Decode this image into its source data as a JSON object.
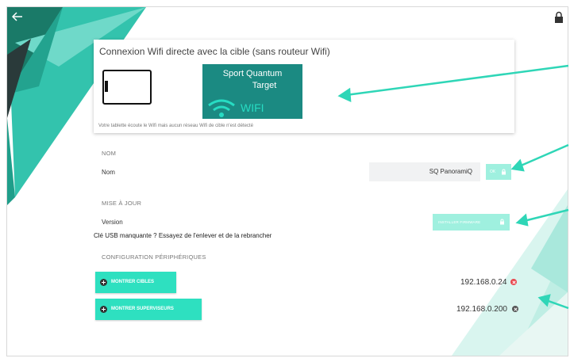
{
  "card": {
    "title": "Connexion Wifi directe avec la cible (sans routeur Wifi)",
    "target_line1": "Sport Quantum",
    "target_line2": "Target",
    "target_wifi": "WIFI",
    "note": "Votre tablette écoute le Wifi mais aucun réseau Wifi de cible n'est détecté"
  },
  "name_section": {
    "header": "NOM",
    "label": "Nom",
    "value": "SQ PanoramiQ",
    "ok_label": "OK"
  },
  "update_section": {
    "header": "MISE À JOUR",
    "label": "Version",
    "install_label": "INSTALLER FIRMWARE",
    "usb_note": "Clé USB manquante ? Essayez de l'enlever et de la rebrancher"
  },
  "peripherals": {
    "header": "CONFIGURATION PÉRIPHÉRIQUES",
    "targets_button": "MONTRER CIBLES",
    "targets_ip": "192.168.0.24",
    "targets_status_color": "#e8464d",
    "supervisors_button": "MONTRER SUPERVISEURS",
    "supervisors_ip": "192.168.0.200",
    "supervisors_status_color": "#555555"
  },
  "colors": {
    "accent": "#2ee0c0",
    "accent_disabled": "#9ff0df",
    "target_box": "#1b8a82",
    "annotation_arrow": "#2fd6b7"
  }
}
